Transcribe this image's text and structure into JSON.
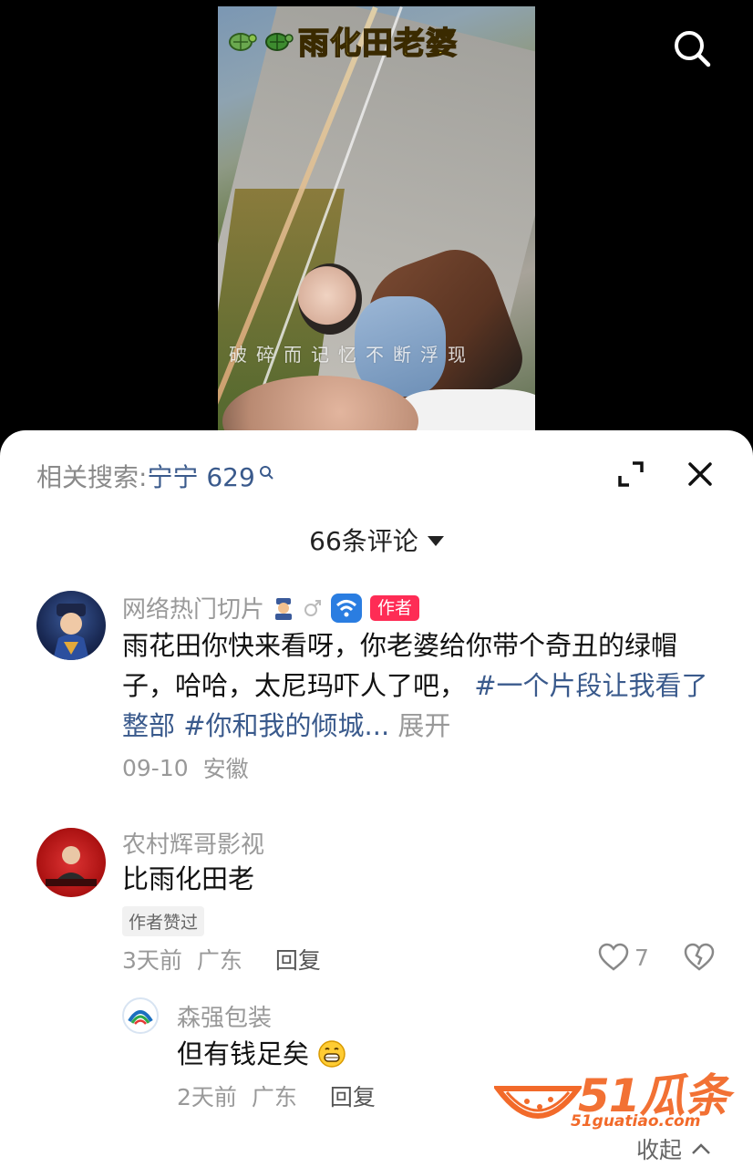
{
  "video": {
    "title": "雨化田老婆",
    "overlay_lyric": "破碎而记忆不断浮现",
    "title_icons": [
      "turtle-icon",
      "turtle-icon"
    ]
  },
  "top_bar": {
    "search_icon": "search-icon"
  },
  "sheet": {
    "related_label": "相关搜索:",
    "related_query": "宁宁 629",
    "comment_count": "66条评论"
  },
  "comments": [
    {
      "username": "网络热门切片",
      "badges": [
        "police-emoji-icon",
        "male-icon",
        "wifi-icon"
      ],
      "author_badge": "作者",
      "text_plain": "雨花田你快来看呀，你老婆给你带个奇丑的绿帽子，哈哈，太尼玛吓人了吧，",
      "tag1": "#一个片段让我看了整部",
      "tag2": "#你和我的倾城...",
      "expand": "展开",
      "date": "09-10",
      "location": "安徽"
    },
    {
      "username": "农村辉哥影视",
      "text": "比雨化田老",
      "liked_by_author": "作者赞过",
      "time": "3天前",
      "location": "广东",
      "reply_label": "回复",
      "likes": "7"
    },
    {
      "username": "森强包装",
      "text": "但有钱足矣",
      "emoji": "grin-emoji-icon",
      "time": "2天前",
      "location": "广东",
      "reply_label": "回复"
    }
  ],
  "collapse_label": "收起",
  "watermark": {
    "main": "51瓜条",
    "sub": "51guatiao.com"
  },
  "colors": {
    "accent_link": "#3a5a8c",
    "author_badge": "#fe2c55",
    "watermark": "#f26a2a"
  }
}
